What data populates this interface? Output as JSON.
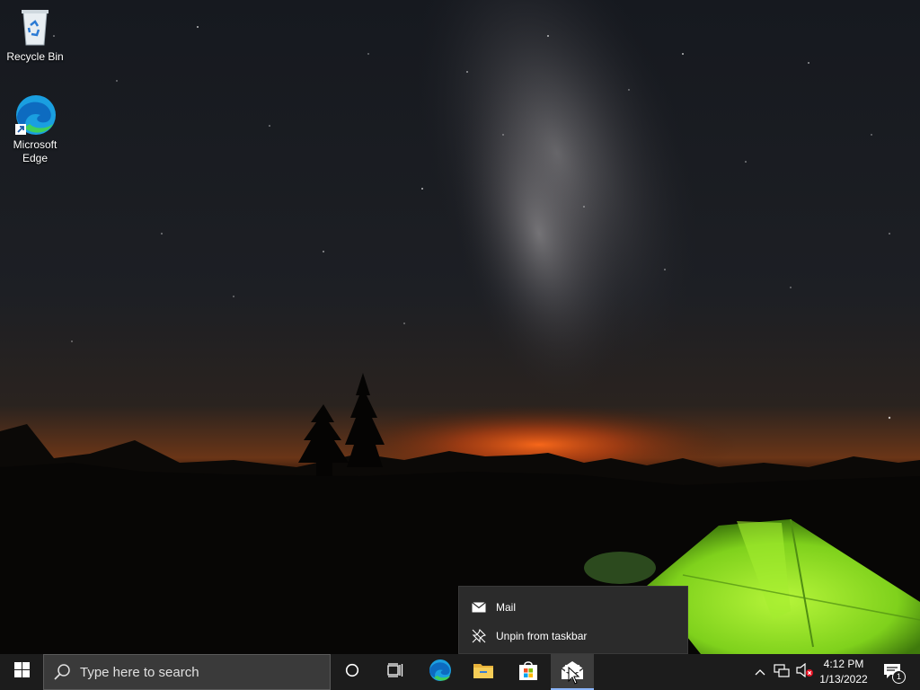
{
  "desktop": {
    "icons": [
      {
        "label": "Recycle Bin"
      },
      {
        "label": "Microsoft\nEdge"
      }
    ]
  },
  "jumplist": {
    "items": [
      {
        "label": "Mail",
        "icon": "mail-icon"
      },
      {
        "label": "Unpin from taskbar",
        "icon": "unpin-icon"
      }
    ]
  },
  "taskbar": {
    "search_placeholder": "Type here to search",
    "pinned": [
      {
        "name": "Microsoft Edge",
        "icon": "edge-icon"
      },
      {
        "name": "File Explorer",
        "icon": "folder-icon"
      },
      {
        "name": "Microsoft Store",
        "icon": "store-icon"
      },
      {
        "name": "Mail",
        "icon": "mail-icon",
        "active": true
      }
    ],
    "clock": {
      "time": "4:12 PM",
      "date": "1/13/2022"
    },
    "notification_count": "1"
  },
  "colors": {
    "taskbar_bg": "#1c1c1c",
    "menu_bg": "#2b2b2b",
    "tent_green": "#8ee02a",
    "horizon_orange": "#e8581a"
  }
}
